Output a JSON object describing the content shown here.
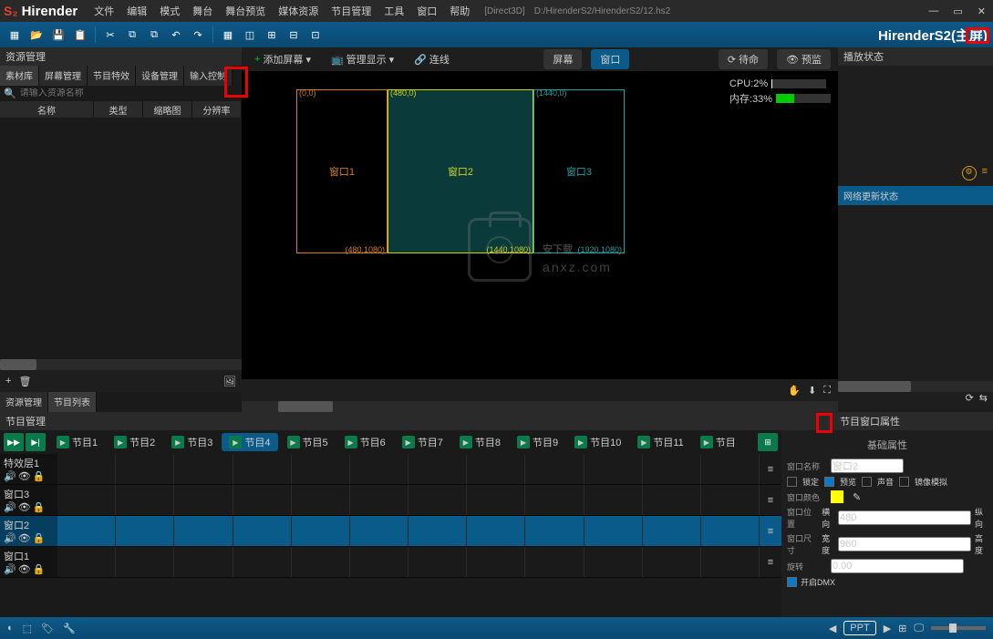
{
  "title": {
    "brand": "Hirender",
    "engine": "[Direct3D]",
    "path": "D:/HirenderS2/HirenderS2/12.hs2",
    "brand2": "HirenderS2(主屏)"
  },
  "menu": [
    "文件",
    "编辑",
    "模式",
    "舞台",
    "舞台预览",
    "媒体资源",
    "节目管理",
    "工具",
    "窗口",
    "帮助"
  ],
  "leftPanel": {
    "title": "资源管理",
    "tabs": [
      "素材库",
      "屏幕管理",
      "节目特效",
      "设备管理",
      "输入控制"
    ],
    "searchPlaceholder": "请输入资源名称",
    "cols": [
      "名称",
      "类型",
      "缩略图",
      "分辨率"
    ],
    "bottomTabs": [
      "资源管理",
      "节目列表"
    ]
  },
  "centerBar": {
    "addScreen": "添加屏幕",
    "mgmtDisplay": "管理显示",
    "connect": "连线",
    "screenBtn": "屏幕",
    "windowBtn": "窗口",
    "standby": "待命",
    "preview": "预监"
  },
  "screens": [
    {
      "name": "窗口1",
      "color": "#d08020",
      "tl": "(0,0)",
      "br": "(480,1080)"
    },
    {
      "name": "窗口2",
      "color": "#d0d020",
      "tl": "(480,0)",
      "br": "(1440,1080)"
    },
    {
      "name": "窗口3",
      "color": "#20a0a0",
      "tl": "(1440,0)",
      "br": "(1920,1080)"
    }
  ],
  "stats": {
    "cpu": "CPU:2%",
    "cpuPct": 2,
    "mem": "内存:33%",
    "memPct": 33
  },
  "watermark": {
    "text": "安下载",
    "sub": "anxz.com"
  },
  "rightPanel": {
    "title": "播放状态",
    "section": "网络更新状态"
  },
  "timeline": {
    "title": "节目管理",
    "propsTitle": "节目窗口属性",
    "programs": [
      "节目1",
      "节目2",
      "节目3",
      "节目4",
      "节目5",
      "节目6",
      "节目7",
      "节目8",
      "节目9",
      "节目10",
      "节目11",
      "节目"
    ],
    "activeProgram": 3,
    "tracks": [
      "特效层1",
      "窗口3",
      "窗口2",
      "窗口1"
    ],
    "selectedTrack": 2
  },
  "props": {
    "header": "基础属性",
    "nameLabel": "窗口名称",
    "nameValue": "窗口2",
    "checks": [
      "锁定",
      "预览",
      "声音",
      "镜像模拟"
    ],
    "colorLabel": "窗口颜色",
    "posLabel": "窗口位置",
    "hLabel": "横向",
    "hVal": "480",
    "vLabel": "纵向",
    "sizeLabel": "窗口尺寸",
    "wLabel": "宽度",
    "wVal": "960",
    "htLabel": "高度",
    "rotLabel": "旋转",
    "rotVal": "0.00",
    "dmxLabel": "开启DMX"
  },
  "status": {
    "ppt": "PPT"
  }
}
